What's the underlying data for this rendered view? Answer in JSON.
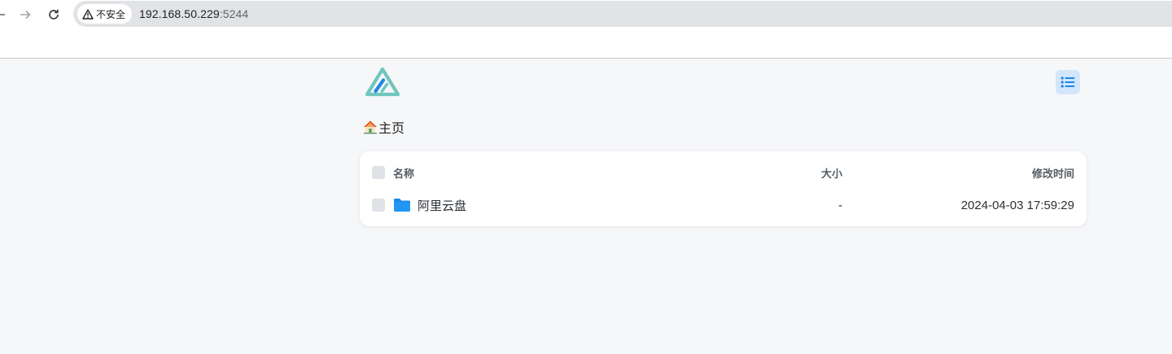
{
  "browser": {
    "security_label": "不安全",
    "url_host": "192.168.50.229",
    "url_port": ":5244"
  },
  "page": {
    "breadcrumb": {
      "home_label": "主页"
    },
    "table": {
      "headers": {
        "name": "名称",
        "size": "大小",
        "modified": "修改时间"
      },
      "rows": [
        {
          "name": "阿里云盘",
          "size": "-",
          "modified": "2024-04-03 17:59:29",
          "icon": "folder-icon"
        }
      ]
    }
  },
  "colors": {
    "accent": "#1e88e5",
    "toggle_bg": "#d3e6fb",
    "logo_primary": "#70c6be",
    "logo_secondary": "#1e88e5"
  }
}
